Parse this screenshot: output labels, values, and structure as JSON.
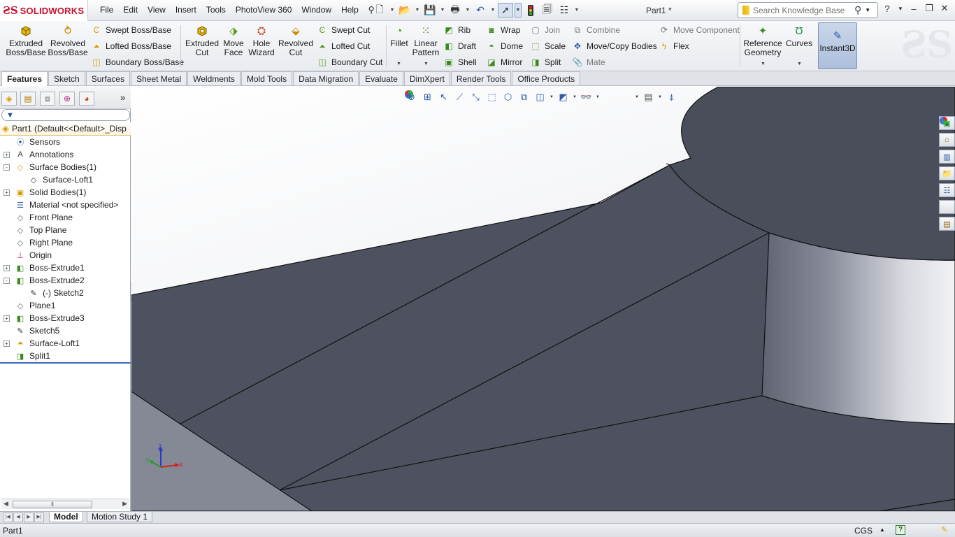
{
  "app": {
    "name": "SOLIDWORKS",
    "document_title": "Part1 *"
  },
  "menu": [
    "File",
    "Edit",
    "View",
    "Insert",
    "Tools",
    "PhotoView 360",
    "Window",
    "Help"
  ],
  "search": {
    "placeholder": "Search Knowledge Base"
  },
  "commands": {
    "extruded_boss": "Extruded Boss/Base",
    "revolved_boss": "Revolved Boss/Base",
    "swept_boss": "Swept Boss/Base",
    "lofted_boss": "Lofted Boss/Base",
    "boundary_boss": "Boundary Boss/Base",
    "extruded_cut": "Extruded Cut",
    "move_face": "Move Face",
    "hole_wizard": "Hole Wizard",
    "revolved_cut": "Revolved Cut",
    "swept_cut": "Swept Cut",
    "lofted_cut": "Lofted Cut",
    "boundary_cut": "Boundary Cut",
    "fillet": "Fillet",
    "linear_pattern": "Linear Pattern",
    "rib": "Rib",
    "draft": "Draft",
    "shell": "Shell",
    "wrap": "Wrap",
    "dome": "Dome",
    "mirror": "Mirror",
    "join": "Join",
    "scale": "Scale",
    "split": "Split",
    "combine": "Combine",
    "move_copy_bodies": "Move/Copy Bodies",
    "mate": "Mate",
    "move_component": "Move Component",
    "flex": "Flex",
    "reference_geometry": "Reference Geometry",
    "curves": "Curves",
    "instant3d": "Instant3D"
  },
  "tabs": [
    "Features",
    "Sketch",
    "Surfaces",
    "Sheet Metal",
    "Weldments",
    "Mold Tools",
    "Data Migration",
    "Evaluate",
    "DimXpert",
    "Render Tools",
    "Office Products"
  ],
  "active_tab": "Features",
  "feature_tree": {
    "root": "Part1  (Default<<Default>_Disp",
    "items": [
      {
        "label": "Sensors",
        "icon": "sensor-icon",
        "indent": 0,
        "expander": ""
      },
      {
        "label": "Annotations",
        "icon": "annotation-icon",
        "indent": 0,
        "expander": "+"
      },
      {
        "label": "Surface Bodies(1)",
        "icon": "surface-bodies-icon",
        "indent": 0,
        "expander": "-"
      },
      {
        "label": "Surface-Loft1",
        "icon": "surface-body-icon",
        "indent": 1,
        "expander": ""
      },
      {
        "label": "Solid Bodies(1)",
        "icon": "solid-bodies-icon",
        "indent": 0,
        "expander": "+"
      },
      {
        "label": "Material <not specified>",
        "icon": "material-icon",
        "indent": 0,
        "expander": ""
      },
      {
        "label": "Front Plane",
        "icon": "plane-icon",
        "indent": 0,
        "expander": ""
      },
      {
        "label": "Top Plane",
        "icon": "plane-icon",
        "indent": 0,
        "expander": ""
      },
      {
        "label": "Right Plane",
        "icon": "plane-icon",
        "indent": 0,
        "expander": ""
      },
      {
        "label": "Origin",
        "icon": "origin-icon",
        "indent": 0,
        "expander": ""
      },
      {
        "label": "Boss-Extrude1",
        "icon": "boss-extrude-icon",
        "indent": 0,
        "expander": "+"
      },
      {
        "label": "Boss-Extrude2",
        "icon": "boss-extrude-icon",
        "indent": 0,
        "expander": "-"
      },
      {
        "label": "(-) Sketch2",
        "icon": "sketch-icon",
        "indent": 1,
        "expander": ""
      },
      {
        "label": "Plane1",
        "icon": "plane-icon",
        "indent": 0,
        "expander": ""
      },
      {
        "label": "Boss-Extrude3",
        "icon": "boss-extrude-icon",
        "indent": 0,
        "expander": "+"
      },
      {
        "label": "Sketch5",
        "icon": "sketch-icon",
        "indent": 0,
        "expander": ""
      },
      {
        "label": "Surface-Loft1",
        "icon": "surface-loft-icon",
        "indent": 0,
        "expander": "+"
      },
      {
        "label": "Split1",
        "icon": "split-icon",
        "indent": 0,
        "expander": ""
      }
    ]
  },
  "triad": {
    "x": "X",
    "y": "Y",
    "z": "Z"
  },
  "bottom_tabs": [
    "Model",
    "Motion Study 1"
  ],
  "status": {
    "left": "Part1",
    "units": "CGS"
  },
  "colors": {
    "body_face": "#4e5260",
    "body_face_light": "#5a5e6b",
    "edge": "#111111",
    "accent": "#c8102e"
  }
}
